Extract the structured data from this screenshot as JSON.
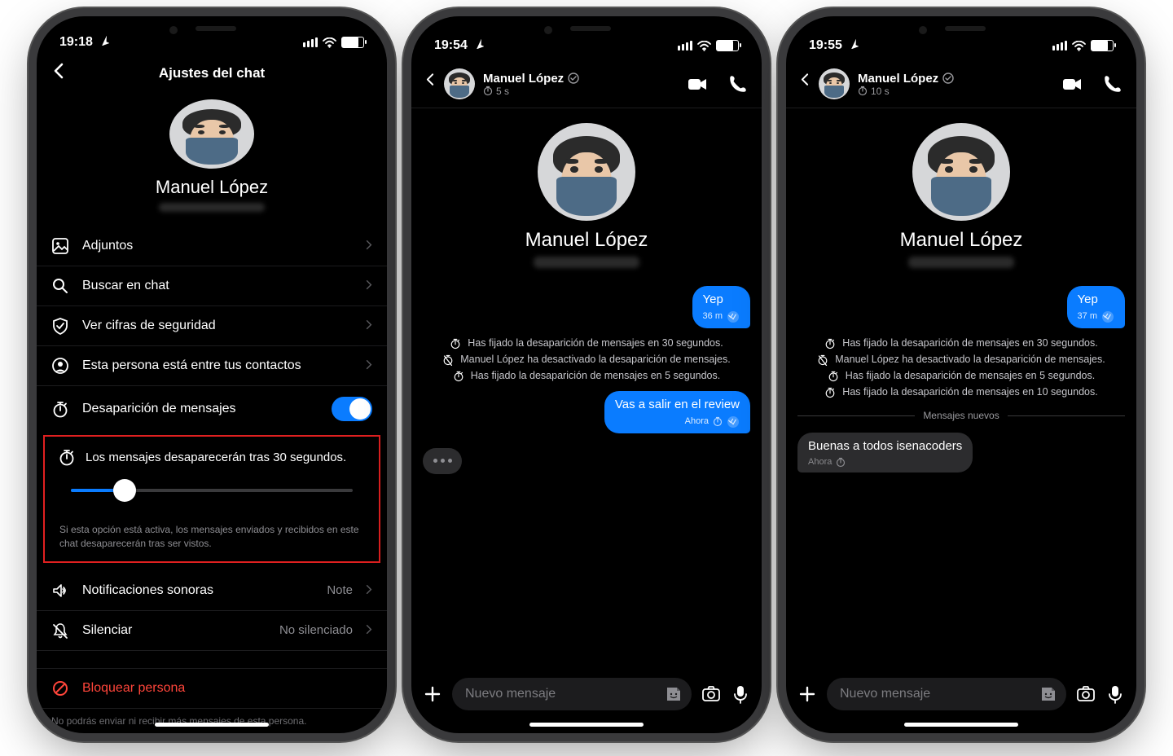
{
  "phone1": {
    "status_time": "19:18",
    "nav_title": "Ajustes del chat",
    "profile_name": "Manuel López",
    "rows": {
      "attachments": "Adjuntos",
      "search": "Buscar en chat",
      "safety": "Ver cifras de seguridad",
      "contact": "Esta persona está entre tus contactos",
      "disappear_toggle": "Desaparición de mensajes",
      "disappear_set": "Los mensajes desaparecerán tras 30 segundos.",
      "sound_label": "Notificaciones sonoras",
      "sound_value": "Note",
      "mute_label": "Silenciar",
      "mute_value": "No silenciado",
      "block": "Bloquear persona"
    },
    "help_text": "Si esta opción está activa, los mensajes enviados y recibidos en este chat desaparecerán tras ser vistos.",
    "block_note": "No podrás enviar ni recibir más mensajes de esta persona.",
    "slider_fraction": 0.19
  },
  "phone2": {
    "status_time": "19:54",
    "header_name": "Manuel López",
    "header_sub": "5 s",
    "center_name": "Manuel López",
    "bubble1_text": "Yep",
    "bubble1_meta": "36 m",
    "sys1": "Has fijado la desaparición de mensajes en 30 segundos.",
    "sys2": "Manuel López ha desactivado la desaparición de mensajes.",
    "sys3": "Has fijado la desaparición de mensajes en 5 segundos.",
    "bubble2_text": "Vas a salir en el review",
    "bubble2_meta": "Ahora",
    "input_placeholder": "Nuevo mensaje"
  },
  "phone3": {
    "status_time": "19:55",
    "header_name": "Manuel López",
    "header_sub": "10 s",
    "center_name": "Manuel López",
    "bubble1_text": "Yep",
    "bubble1_meta": "37 m",
    "sys1": "Has fijado la desaparición de mensajes en 30 segundos.",
    "sys2": "Manuel López ha desactivado la desaparición de mensajes.",
    "sys3": "Has fijado la desaparición de mensajes en 5 segundos.",
    "sys4": "Has fijado la desaparición de mensajes en 10 segundos.",
    "new_divider": "Mensajes nuevos",
    "in_text": "Buenas a todos  isenacoders",
    "in_meta": "Ahora",
    "input_placeholder": "Nuevo mensaje"
  }
}
